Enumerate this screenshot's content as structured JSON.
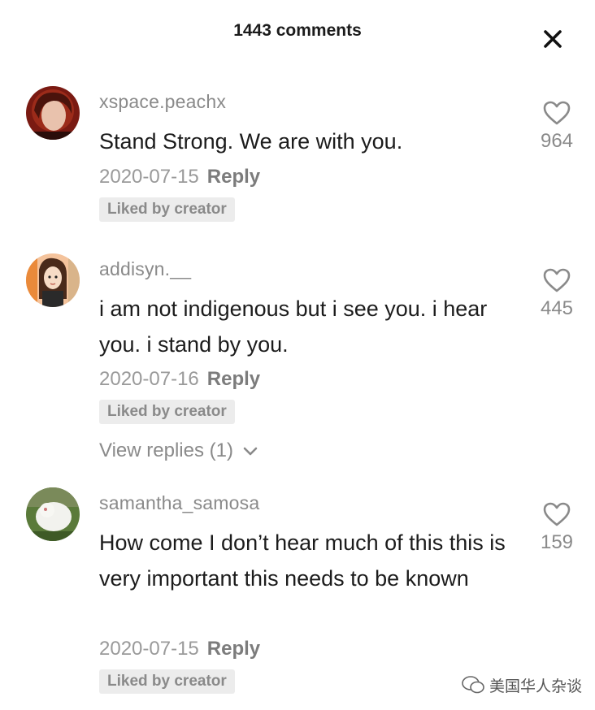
{
  "header": {
    "title": "1443 comments"
  },
  "comments": [
    {
      "username": "xspace.peachx",
      "text": "Stand Strong. We are with you.",
      "date": "2020-07-15",
      "reply_label": "Reply",
      "badge": "Liked by creator",
      "likes": "964"
    },
    {
      "username": "addisyn.__",
      "text": "i am not indigenous but i see you. i hear you. i stand by you.",
      "date": "2020-07-16",
      "reply_label": "Reply",
      "badge": "Liked by creator",
      "likes": "445",
      "view_replies": "View replies (1)"
    },
    {
      "username": "samantha_samosa",
      "text": "How come I don’t hear much of this this is very important this needs to be known",
      "date": "2020-07-15",
      "reply_label": "Reply",
      "badge": "Liked by creator",
      "likes": "159"
    }
  ],
  "watermark": {
    "text": "美国华人杂谈"
  },
  "icons": {
    "close": "close-icon",
    "heart": "heart-icon",
    "chevron": "chevron-down-icon"
  }
}
